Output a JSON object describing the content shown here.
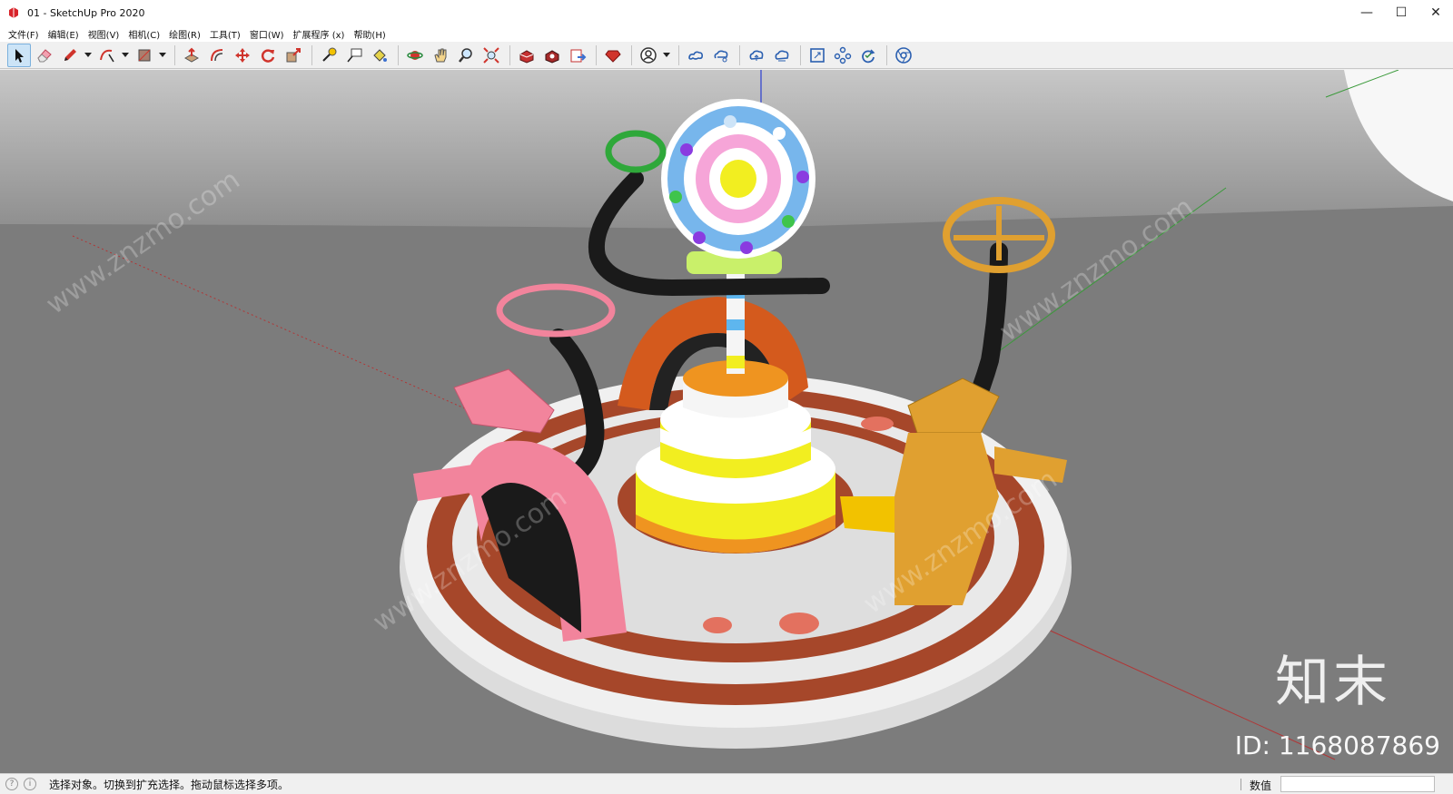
{
  "window": {
    "title": "01 - SketchUp Pro 2020",
    "controls": {
      "minimize": "—",
      "maximize": "☐",
      "close": "✕"
    }
  },
  "menu": [
    "文件(F)",
    "编辑(E)",
    "视图(V)",
    "相机(C)",
    "绘图(R)",
    "工具(T)",
    "窗口(W)",
    "扩展程序 (x)",
    "帮助(H)"
  ],
  "toolbar": {
    "tools": [
      "select-icon",
      "eraser-icon",
      "pencil-icon",
      "arc-icon",
      "rectangle-icon",
      "push-pull-icon",
      "offset-icon",
      "move-icon",
      "rotate-icon",
      "scale-icon",
      "tape-measure-icon",
      "text-icon",
      "paint-bucket-icon",
      "orbit-icon",
      "pan-icon",
      "zoom-icon",
      "zoom-extents-icon",
      "warehouse-icon",
      "extension-warehouse-icon",
      "send-to-layout-icon",
      "ruby-console-icon",
      "account-icon",
      "add-location-icon",
      "cloud-share-icon",
      "cloud-upload-icon",
      "cloud-sync-icon",
      "model-info-icon",
      "components-icon",
      "refresh-icon",
      "chrome-icon"
    ]
  },
  "viewport": {
    "watermark_logo": "知末",
    "watermark_id": "ID: 1168087869",
    "colors": {
      "background": "#7c7c7c",
      "sky": "#bcbcbc",
      "pink": "#f2849c",
      "orange": "#e0a030",
      "cake_yellow": "#f2ee20",
      "base_white": "#f0f0f0",
      "base_brown": "#a6472a"
    }
  },
  "status": {
    "text": "选择对象。切换到扩充选择。拖动鼠标选择多项。",
    "measure_label": "数值",
    "measure_value": ""
  }
}
